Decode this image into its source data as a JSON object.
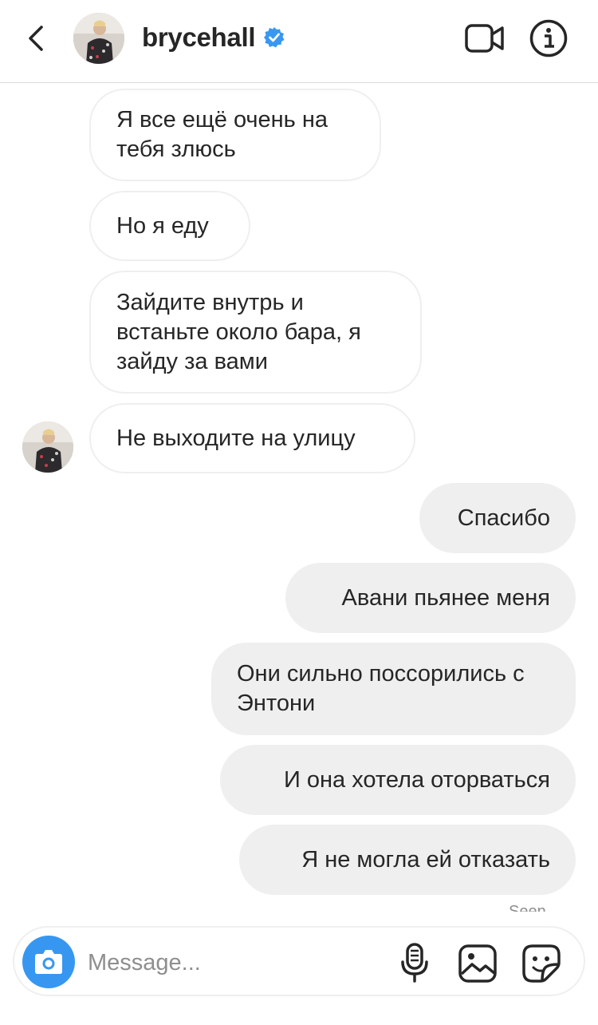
{
  "header": {
    "username": "brycehall",
    "icons": [
      "back-chevron",
      "avatar",
      "verified-badge",
      "video-call",
      "info"
    ]
  },
  "messages": [
    {
      "direction": "incoming",
      "text": "Я все ещё очень на тебя злюсь"
    },
    {
      "direction": "incoming",
      "text": "Но я еду"
    },
    {
      "direction": "incoming",
      "text": "Зайдите внутрь и встаньте около бара, я зайду за вами"
    },
    {
      "direction": "incoming",
      "text": "Не выходите на улицу"
    },
    {
      "direction": "outgoing",
      "text": "Спасибо"
    },
    {
      "direction": "outgoing",
      "text": "Авани пьянее меня"
    },
    {
      "direction": "outgoing",
      "text": "Они сильно поссорились с Энтони"
    },
    {
      "direction": "outgoing",
      "text": "И она хотела оторваться"
    },
    {
      "direction": "outgoing",
      "text": "Я не могла ей отказать"
    }
  ],
  "status": {
    "seen": "Seen"
  },
  "composer": {
    "placeholder": "Message...",
    "icons": [
      "camera",
      "microphone",
      "gallery",
      "sticker"
    ]
  },
  "colors": {
    "accent": "#3797f0",
    "verified": "#3897f0",
    "outgoing_bubble": "#efefef",
    "border": "#dbdbdb"
  }
}
